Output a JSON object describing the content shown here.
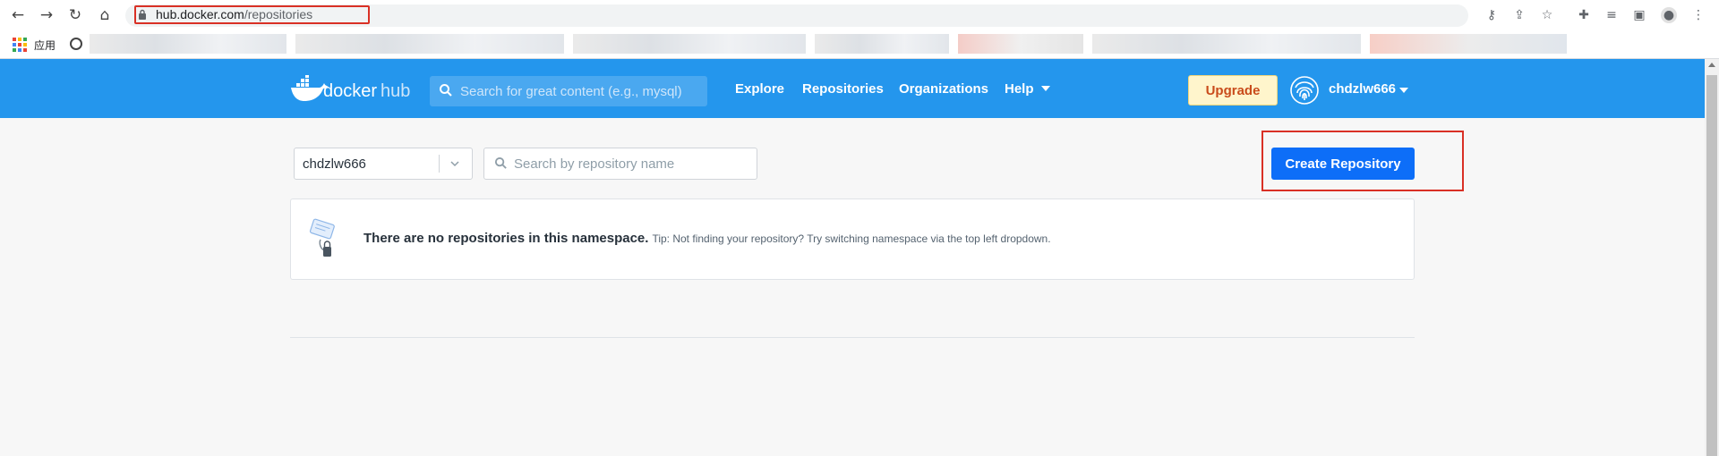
{
  "browser": {
    "url_host": "hub.docker.com",
    "url_path": "/repositories",
    "apps_label": "应用"
  },
  "navbar": {
    "logo_text_docker": "docker",
    "logo_text_hub": "hub",
    "search_placeholder": "Search for great content (e.g., mysql)",
    "links": {
      "explore": "Explore",
      "repositories": "Repositories",
      "organizations": "Organizations",
      "help": "Help"
    },
    "upgrade_label": "Upgrade",
    "username": "chdzlw666"
  },
  "main": {
    "namespace_selected": "chdzlw666",
    "repo_search_placeholder": "Search by repository name",
    "create_button_label": "Create Repository",
    "empty_message": "There are no repositories in this namespace.",
    "empty_tip": "Tip: Not finding your repository? Try switching namespace via the top left dropdown."
  },
  "colors": {
    "navbar_bg": "#2496ed",
    "primary_button": "#0d6ef8",
    "upgrade_bg": "#fff5cc",
    "upgrade_text": "#c94b1b",
    "highlight_red": "#d93025"
  },
  "icons": [
    "back-icon",
    "forward-icon",
    "reload-icon",
    "home-icon",
    "lock-icon",
    "key-icon",
    "share-icon",
    "star-icon",
    "extensions-icon",
    "media-icon",
    "side-panel-icon",
    "profile-icon",
    "menu-icon",
    "apps-icon",
    "globe-icon",
    "docker-logo",
    "search-icon",
    "fingerprint-avatar-icon",
    "chevron-down-icon",
    "empty-repo-icon"
  ]
}
